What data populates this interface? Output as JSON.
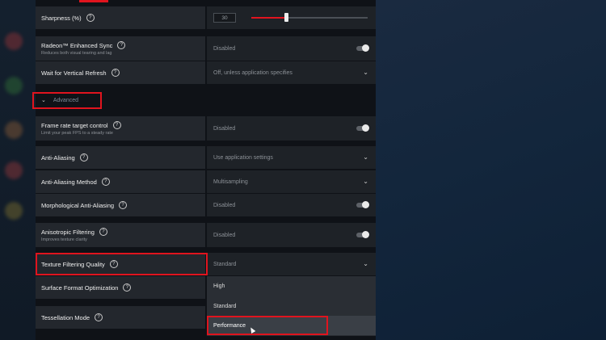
{
  "settings": {
    "sharpness": {
      "label": "Sharpness (%)",
      "value": "30",
      "level_percent": 30
    },
    "enhanced_sync": {
      "label": "Radeon™ Enhanced Sync",
      "sub": "Reduces both visual tearing and lag",
      "value": "Disabled"
    },
    "vertical_refresh": {
      "label": "Wait for Vertical Refresh",
      "value": "Off, unless application specifies"
    },
    "advanced": {
      "label": "Advanced"
    },
    "frame_rate_target": {
      "label": "Frame rate target control",
      "sub": "Limit your peak FPS to a steady rate",
      "value": "Disabled"
    },
    "anti_aliasing": {
      "label": "Anti-Aliasing",
      "value": "Use application settings"
    },
    "aa_method": {
      "label": "Anti-Aliasing Method",
      "value": "Multisampling"
    },
    "morphological_aa": {
      "label": "Morphological Anti-Aliasing",
      "value": "Disabled"
    },
    "anisotropic": {
      "label": "Anisotropic Filtering",
      "sub": "Improves texture clarity",
      "value": "Disabled"
    },
    "texture_quality": {
      "label": "Texture Filtering Quality",
      "value": "Standard"
    },
    "surface_format": {
      "label": "Surface Format Optimization"
    },
    "tessellation": {
      "label": "Tessellation Mode"
    }
  },
  "dropdown": {
    "options": [
      "High",
      "Standard",
      "Performance"
    ],
    "hovered": "Performance"
  },
  "icons": {
    "help": "?",
    "chevron_down": "⌄",
    "chevron_down_small": "⌄"
  },
  "colors": {
    "accent_red": "#e0141e",
    "row_label_bg": "#23272d",
    "row_value_bg": "#1e2227"
  }
}
